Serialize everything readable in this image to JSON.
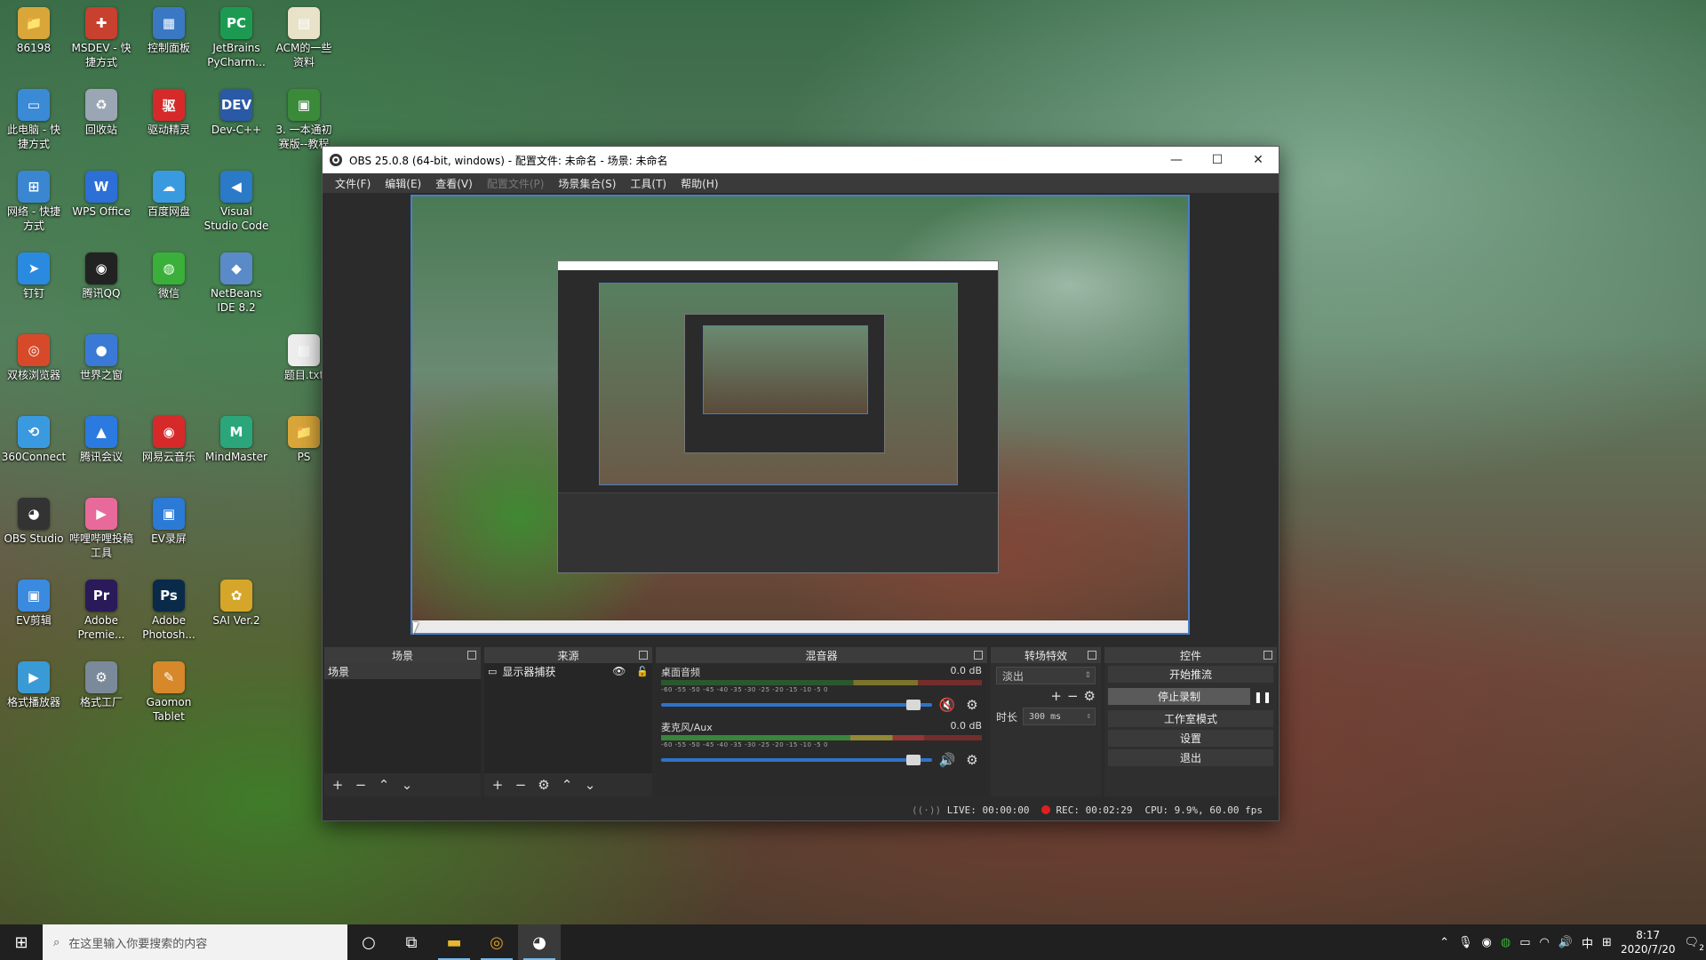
{
  "desktop": {
    "icons": [
      {
        "label": "86198",
        "glyph": "📁",
        "color": "#d9a63a"
      },
      {
        "label": "MSDEV - 快\n捷方式",
        "glyph": "✚",
        "color": "#c8402e"
      },
      {
        "label": "控制面板",
        "glyph": "▦",
        "color": "#3b78c4"
      },
      {
        "label": "JetBrains\nPyCharm...",
        "glyph": "PC",
        "color": "#1d9a52"
      },
      {
        "label": "ACM的一些\n资料",
        "glyph": "▤",
        "color": "#e8e2c8"
      },
      {
        "label": "此电脑 - 快\n捷方式",
        "glyph": "▭",
        "color": "#3a8ad6"
      },
      {
        "label": "回收站",
        "glyph": "♻",
        "color": "#9aa6b4"
      },
      {
        "label": "驱动精灵",
        "glyph": "驱",
        "color": "#d62a2a"
      },
      {
        "label": "Dev-C++",
        "glyph": "DEV",
        "color": "#2a5aa6"
      },
      {
        "label": "3. 一本通初\n赛版--教程",
        "glyph": "▣",
        "color": "#3a8a3a"
      },
      {
        "label": "网络 - 快捷\n方式",
        "glyph": "⊞",
        "color": "#3a86d0"
      },
      {
        "label": "WPS Office",
        "glyph": "W",
        "color": "#2c6fd6"
      },
      {
        "label": "百度网盘",
        "glyph": "☁",
        "color": "#3a9ae0"
      },
      {
        "label": "Visual\nStudio Code",
        "glyph": "◀",
        "color": "#2a7ac8"
      },
      {
        "label": "钉钉",
        "glyph": "➤",
        "color": "#2a8ae0"
      },
      {
        "label": "腾讯QQ",
        "glyph": "◉",
        "color": "#222222"
      },
      {
        "label": "微信",
        "glyph": "◍",
        "color": "#3ab03a"
      },
      {
        "label": "NetBeans\nIDE 8.2",
        "glyph": "◆",
        "color": "#5a8ac8"
      },
      {
        "label": "双核浏览器",
        "glyph": "◎",
        "color": "#d64a2a"
      },
      {
        "label": "世界之窗",
        "glyph": "●",
        "color": "#3a7ad6"
      },
      {
        "label": "题目.txt",
        "glyph": "▤",
        "color": "#eeeeee"
      },
      {
        "label": "360Connect",
        "glyph": "⟲",
        "color": "#3a9ae0"
      },
      {
        "label": "腾讯会议",
        "glyph": "▲",
        "color": "#2a7ae0"
      },
      {
        "label": "网易云音乐",
        "glyph": "◉",
        "color": "#d62a2a"
      },
      {
        "label": "MindMaster",
        "glyph": "M",
        "color": "#2aa67a"
      },
      {
        "label": "PS",
        "glyph": "📁",
        "color": "#d9a63a"
      },
      {
        "label": "OBS Studio",
        "glyph": "◕",
        "color": "#333333"
      },
      {
        "label": "哔哩哔哩投稿\n工具",
        "glyph": "▶",
        "color": "#e86a9a"
      },
      {
        "label": "EV录屏",
        "glyph": "▣",
        "color": "#2a7ad6"
      },
      {
        "label": "EV剪辑",
        "glyph": "▣",
        "color": "#3a8ae0"
      },
      {
        "label": "Adobe\nPremie...",
        "glyph": "Pr",
        "color": "#2a1a5a"
      },
      {
        "label": "Adobe\nPhotosh...",
        "glyph": "Ps",
        "color": "#0a2a4a"
      },
      {
        "label": "SAI Ver.2",
        "glyph": "✿",
        "color": "#d6a62a"
      },
      {
        "label": "格式播放器",
        "glyph": "▶",
        "color": "#3a9ad6"
      },
      {
        "label": "格式工厂",
        "glyph": "⚙",
        "color": "#7a8a9a"
      },
      {
        "label": "Gaomon\nTablet",
        "glyph": "✎",
        "color": "#d6882a"
      }
    ]
  },
  "obs": {
    "title": "OBS 25.0.8 (64-bit, windows) - 配置文件: 未命名 - 场景: 未命名",
    "menu": [
      "文件(F)",
      "编辑(E)",
      "查看(V)",
      "配置文件(P)",
      "场景集合(S)",
      "工具(T)",
      "帮助(H)"
    ],
    "menu_disabled_index": 3,
    "window_buttons": {
      "minimize": "—",
      "maximize": "☐",
      "close": "✕"
    },
    "docks": {
      "scenes": {
        "title": "场景",
        "items": [
          "场景"
        ]
      },
      "sources": {
        "title": "来源",
        "items": [
          "显示器捕获"
        ]
      },
      "mixer": {
        "title": "混音器",
        "channels": [
          {
            "name": "桌面音频",
            "db": "0.0 dB",
            "level_pct": 0,
            "volume_pct": 93,
            "muted": true
          },
          {
            "name": "麦克风/Aux",
            "db": "0.0 dB",
            "level_pct": 82,
            "volume_pct": 93,
            "muted": false
          }
        ],
        "ticks": "-60  -55  -50  -45  -40  -35  -30  -25  -20  -15  -10  -5  0"
      },
      "transitions": {
        "title": "转场特效",
        "selected": "淡出",
        "duration_label": "时长",
        "duration_value": "300 ms"
      },
      "controls": {
        "title": "控件",
        "buttons": [
          "开始推流",
          "停止录制",
          "工作室模式",
          "设置",
          "退出"
        ],
        "active_index": 1
      }
    },
    "status": {
      "live": "LIVE: 00:00:00",
      "rec": "REC: 00:02:29",
      "cpu": "CPU: 9.9%, 60.00 fps"
    }
  },
  "taskbar": {
    "search_placeholder": "在这里输入你要搜索的内容",
    "clock_time": "8:17",
    "clock_date": "2020/7/20",
    "ime": "中",
    "notification_count": "2"
  }
}
